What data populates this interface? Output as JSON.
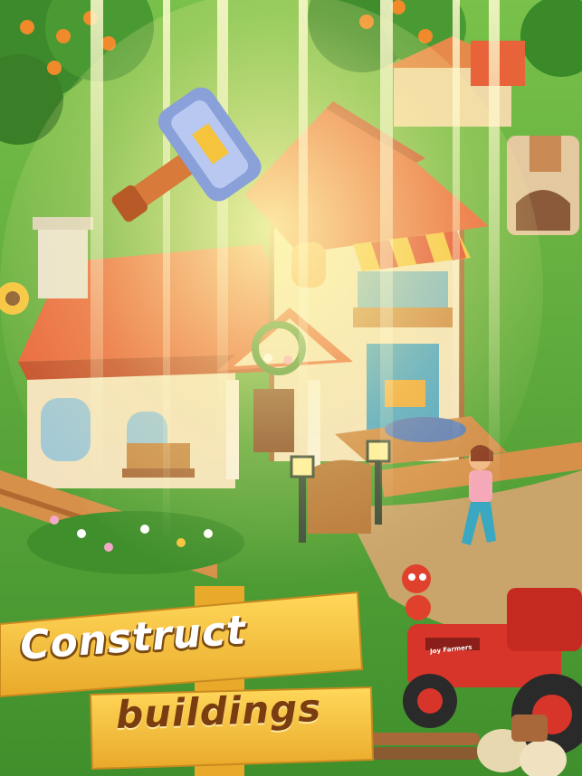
{
  "banner": {
    "line1": "Construct",
    "line2": "buildings"
  },
  "tractor": {
    "brand": "Joy Farmers"
  },
  "colors": {
    "grass": "#5aa73a",
    "roof": "#e8623a",
    "wall": "#f3e2bf",
    "wood_plank": "#f6c33d",
    "tractor": "#d8352a",
    "banner_text_primary": "#ffffff",
    "banner_text_secondary": "#7a3d10"
  },
  "icons": [
    "hammer-icon"
  ]
}
